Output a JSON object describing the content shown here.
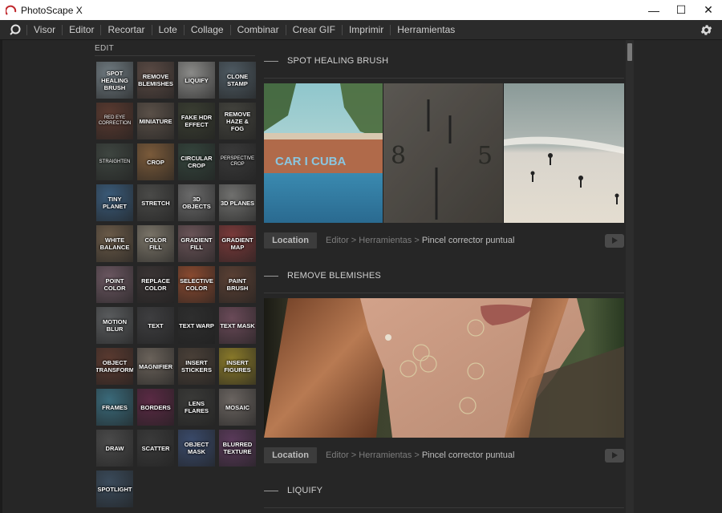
{
  "window": {
    "title": "PhotoScape X",
    "controls": {
      "minimize": "—",
      "maximize": "☐",
      "close": "✕"
    }
  },
  "menu": {
    "items": [
      "Visor",
      "Editor",
      "Recortar",
      "Lote",
      "Collage",
      "Combinar",
      "Crear GIF",
      "Imprimir",
      "Herramientas"
    ],
    "logo_icon": "photoscape-ring-icon",
    "settings_icon": "gear-icon"
  },
  "sidebar": {
    "heading": "EDIT",
    "tools": [
      {
        "label": "SPOT HEALING BRUSH",
        "color": "#6f7a80"
      },
      {
        "label": "REMOVE BLEMISHES",
        "color": "#5a4a44"
      },
      {
        "label": "LIQUIFY",
        "color": "#8a8a88"
      },
      {
        "label": "CLONE STAMP",
        "color": "#4e5a62"
      },
      {
        "label": "RED EYE CORRECTION",
        "color": "#5a3a30"
      },
      {
        "label": "MINIATURE",
        "color": "#5a5048"
      },
      {
        "label": "FAKE HDR EFFECT",
        "color": "#3a3e32"
      },
      {
        "label": "REMOVE HAZE & FOG",
        "color": "#44443e"
      },
      {
        "label": "STRAIGHTEN",
        "color": "#3e4540"
      },
      {
        "label": "CROP",
        "color": "#7a5a3a"
      },
      {
        "label": "CIRCULAR CROP",
        "color": "#34443c"
      },
      {
        "label": "PERSPECTIVE CROP",
        "color": "#3a3a3a"
      },
      {
        "label": "TINY PLANET",
        "color": "#3a5a78"
      },
      {
        "label": "STRETCH",
        "color": "#4a4a48"
      },
      {
        "label": "3D OBJECTS",
        "color": "#6a6a6a"
      },
      {
        "label": "3D PLANES",
        "color": "#70706e"
      },
      {
        "label": "WHITE BALANCE",
        "color": "#6a5a48"
      },
      {
        "label": "COLOR FILL",
        "color": "#7a7468"
      },
      {
        "label": "GRADIENT FILL",
        "color": "#6a5458"
      },
      {
        "label": "GRADIENT MAP",
        "color": "#7a3a3a"
      },
      {
        "label": "POINT COLOR",
        "color": "#6a5660"
      },
      {
        "label": "REPLACE COLOR",
        "color": "#3a3434"
      },
      {
        "label": "SELECTIVE COLOR",
        "color": "#8a4a30"
      },
      {
        "label": "PAINT BRUSH",
        "color": "#5a4034"
      },
      {
        "label": "MOTION BLUR",
        "color": "#5a5c5e"
      },
      {
        "label": "TEXT",
        "color": "#3e3e40"
      },
      {
        "label": "TEXT WARP",
        "color": "#2e2e2e"
      },
      {
        "label": "TEXT MASK",
        "color": "#6a4a58"
      },
      {
        "label": "OBJECT TRANSFORM",
        "color": "#5a3a30"
      },
      {
        "label": "MAGNIFIER",
        "color": "#6a625a"
      },
      {
        "label": "INSERT STICKERS",
        "color": "#4a4038"
      },
      {
        "label": "INSERT FIGURES",
        "color": "#8a7a2a"
      },
      {
        "label": "FRAMES",
        "color": "#3a6a7a"
      },
      {
        "label": "BORDERS",
        "color": "#5a2a44"
      },
      {
        "label": "LENS FLARES",
        "color": "#3a3a38"
      },
      {
        "label": "MOSAIC",
        "color": "#6a6460"
      },
      {
        "label": "DRAW",
        "color": "#4a4a4a"
      },
      {
        "label": "SCATTER",
        "color": "#3a3a3a"
      },
      {
        "label": "OBJECT MASK",
        "color": "#3a4a6a"
      },
      {
        "label": "BLURRED TEXTURE",
        "color": "#5a3a5a"
      },
      {
        "label": "SPOTLIGHT",
        "color": "#3a4a5a"
      }
    ]
  },
  "sections": [
    {
      "title": "SPOT HEALING BRUSH",
      "location_label": "Location",
      "path": "Editor > Herramientas > ",
      "current": "Pincel corrector puntual"
    },
    {
      "title": "REMOVE BLEMISHES",
      "location_label": "Location",
      "path": "Editor > Herramientas > ",
      "current": "Pincel corrector puntual"
    },
    {
      "title": "LIQUIFY"
    }
  ],
  "photo1_text": [
    "CAR I CUBA",
    "8",
    "5"
  ]
}
